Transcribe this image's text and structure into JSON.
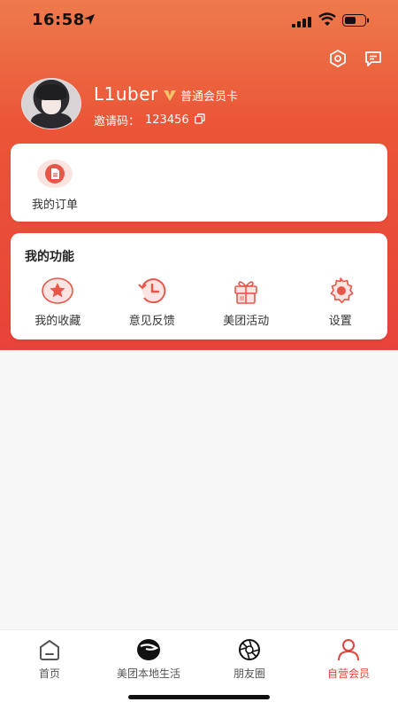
{
  "status_bar": {
    "time": "16:58"
  },
  "profile": {
    "username": "L1uber",
    "member_badge": "普通会员卡",
    "invite_label": "邀请码：",
    "invite_code": "123456"
  },
  "orders": {
    "label": "我的订单"
  },
  "functions": {
    "title": "我的功能",
    "items": [
      {
        "label": "我的收藏",
        "icon": "favorites-icon"
      },
      {
        "label": "意见反馈",
        "icon": "feedback-icon"
      },
      {
        "label": "美团活动",
        "icon": "gift-icon"
      },
      {
        "label": "设置",
        "icon": "settings-icon"
      }
    ]
  },
  "tabbar": {
    "items": [
      {
        "label": "首页",
        "icon": "home-icon"
      },
      {
        "label": "美团本地生活",
        "icon": "local-life-icon"
      },
      {
        "label": "朋友圈",
        "icon": "moments-icon"
      },
      {
        "label": "自营会员",
        "icon": "member-icon",
        "active": true
      }
    ]
  },
  "colors": {
    "accent": "#e8433a",
    "gradient_top": "#ee7a4c",
    "icon_tint": "#e8433a"
  }
}
